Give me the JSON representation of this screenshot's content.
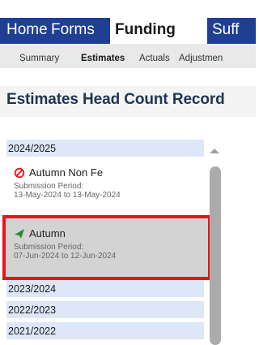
{
  "topnav": {
    "tabs": [
      {
        "label": "Home"
      },
      {
        "label": "Forms"
      },
      {
        "label": "Funding"
      },
      {
        "label": "Suff"
      }
    ]
  },
  "subnav": {
    "items": [
      {
        "label": "Summary"
      },
      {
        "label": "Estimates"
      },
      {
        "label": "Actuals"
      },
      {
        "label": "Adjustmen"
      }
    ]
  },
  "page": {
    "title": "Estimates Head Count Record"
  },
  "periods": {
    "years": [
      "2024/2025",
      "2023/2024",
      "2022/2023",
      "2021/2022"
    ],
    "items": [
      {
        "title": "Autumn Non Fe",
        "icon": "blocked-icon",
        "submission_label": "Submission Period:",
        "dates": "13-May-2024 to 13-May-2024"
      },
      {
        "title": "Autumn",
        "icon": "send-arrow-icon",
        "submission_label": "Submission Period:",
        "dates": "07-Jun-2024 to 12-Jun-2024"
      }
    ]
  },
  "colors": {
    "nav_bg": "#1f3f95",
    "selection_border": "#e8141b",
    "year_row_bg": "#dde7f8",
    "blocked_icon": "#e8141b",
    "send_icon": "#2e8b2e"
  }
}
